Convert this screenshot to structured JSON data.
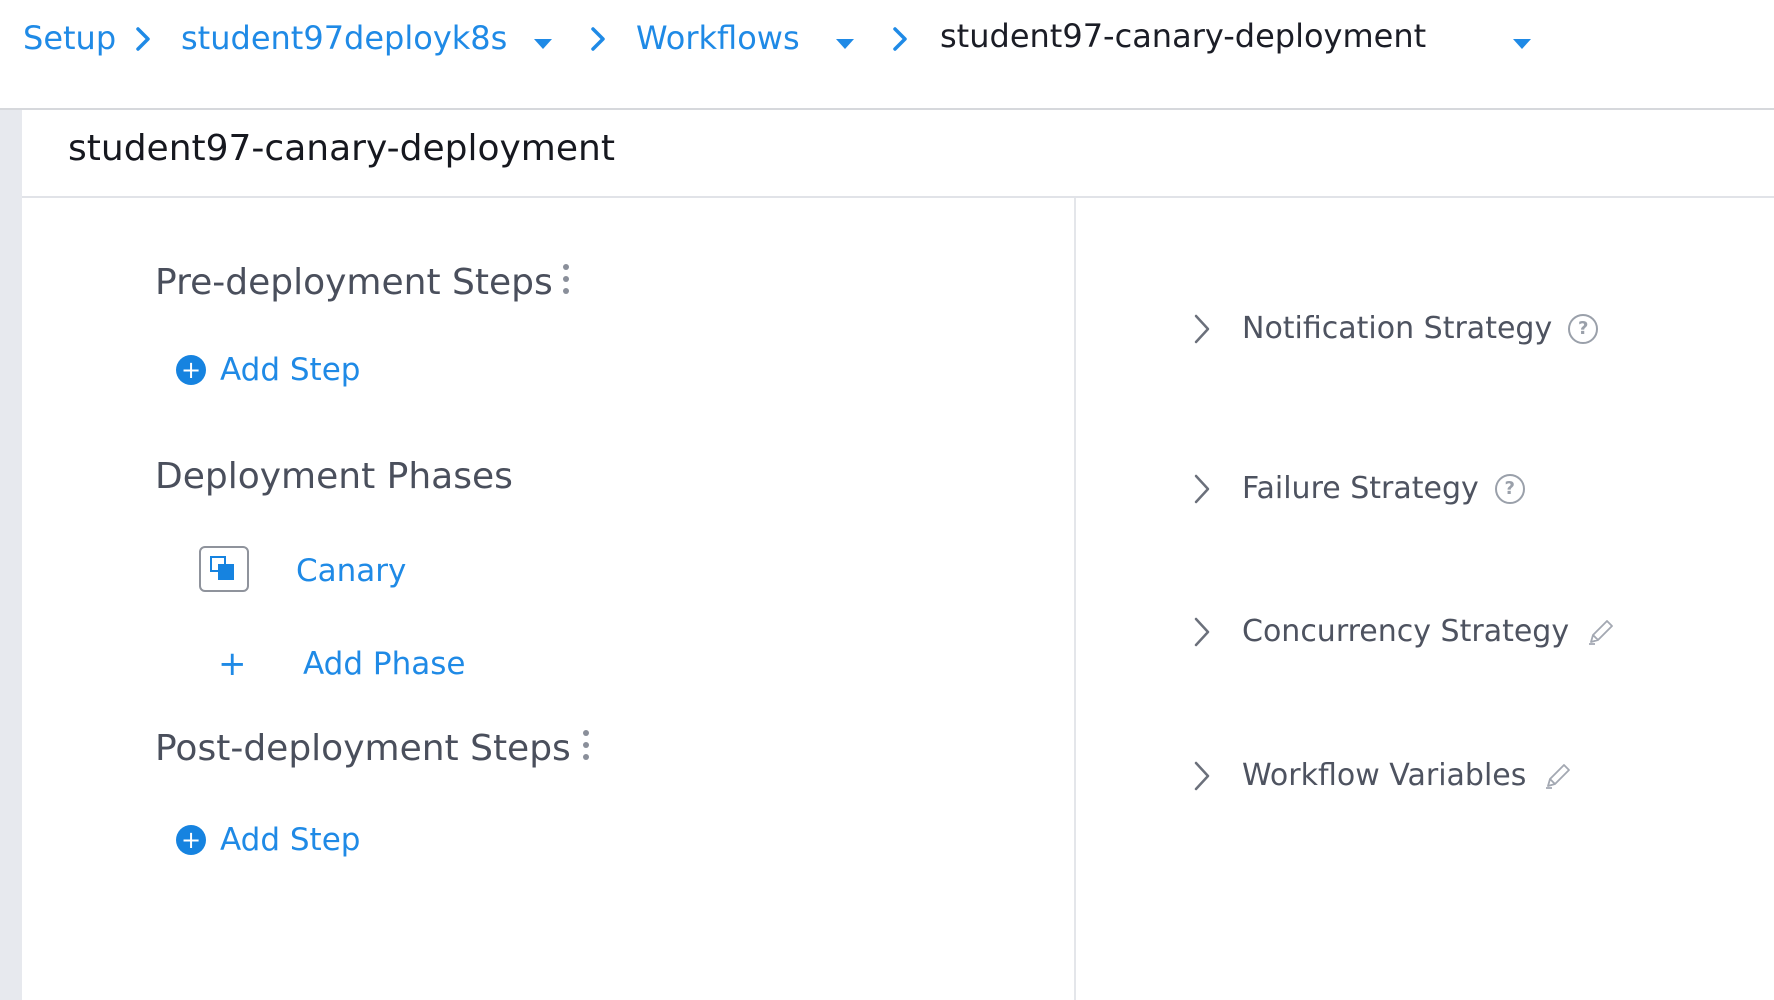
{
  "breadcrumb": {
    "setup": "Setup",
    "application": "student97deployk8s",
    "workflows": "Workflows",
    "workflow": "student97-canary-deployment"
  },
  "page": {
    "title": "student97-canary-deployment"
  },
  "workflow": {
    "pre_deployment": {
      "heading": "Pre-deployment Steps",
      "add_step": "Add Step"
    },
    "deployment_phases": {
      "heading": "Deployment Phases",
      "phases": [
        {
          "label": "Canary"
        }
      ],
      "add_phase": "Add Phase",
      "add_phase_symbol": "+"
    },
    "post_deployment": {
      "heading": "Post-deployment Steps",
      "add_step": "Add Step"
    }
  },
  "strategies": [
    {
      "label": "Notification Strategy",
      "icon": "help-icon"
    },
    {
      "label": "Failure Strategy",
      "icon": "help-icon"
    },
    {
      "label": "Concurrency Strategy",
      "icon": "pencil-icon"
    },
    {
      "label": "Workflow Variables",
      "icon": "pencil-icon"
    }
  ],
  "colors": {
    "link": "#1f8ae6",
    "accent": "#1683e0",
    "muted": "#4e5360"
  }
}
